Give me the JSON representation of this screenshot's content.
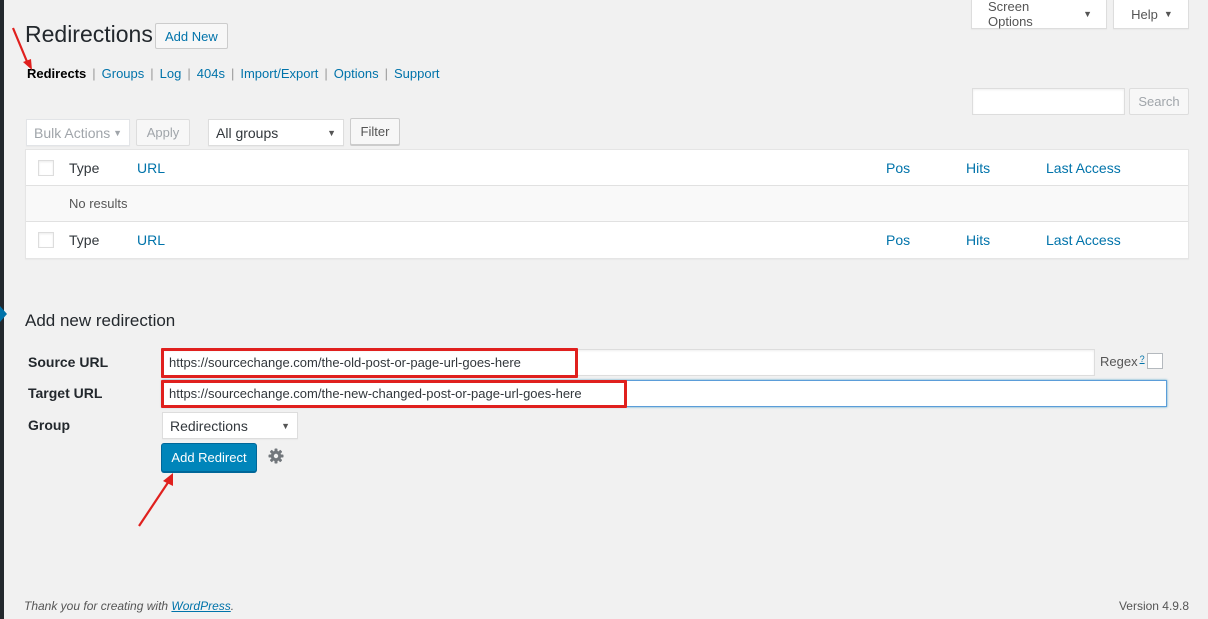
{
  "header": {
    "screen_options": "Screen Options",
    "help": "Help",
    "title": "Redirections",
    "add_new": "Add New"
  },
  "subnav": [
    "Redirects",
    "Groups",
    "Log",
    "404s",
    "Import/Export",
    "Options",
    "Support"
  ],
  "search": {
    "placeholder": "",
    "button": "Search"
  },
  "toolbar": {
    "bulk_actions": "Bulk Actions",
    "apply": "Apply",
    "groups_filter": "All groups",
    "filter": "Filter"
  },
  "table": {
    "columns": {
      "type": "Type",
      "url": "URL",
      "pos": "Pos",
      "hits": "Hits",
      "last_access": "Last Access"
    },
    "empty_message": "No results"
  },
  "form": {
    "title": "Add new redirection",
    "source_label": "Source URL",
    "source_value": "https://sourcechange.com/the-old-post-or-page-url-goes-here",
    "target_label": "Target URL",
    "target_value": "https://sourcechange.com/the-new-changed-post-or-page-url-goes-here",
    "regex_label": "Regex",
    "regex_help": "?",
    "group_label": "Group",
    "group_value": "Redirections",
    "submit": "Add Redirect"
  },
  "footer": {
    "thanks_prefix": "Thank you for creating with",
    "thanks_link": "WordPress",
    "thanks_suffix": ".",
    "version": "Version 4.9.8"
  },
  "colors": {
    "accent": "#0073aa",
    "primary_button": "#0085ba",
    "highlight": "#e0201e"
  },
  "icons": [
    "caret-down-icon",
    "gear-icon",
    "annotation-arrow-icon"
  ]
}
